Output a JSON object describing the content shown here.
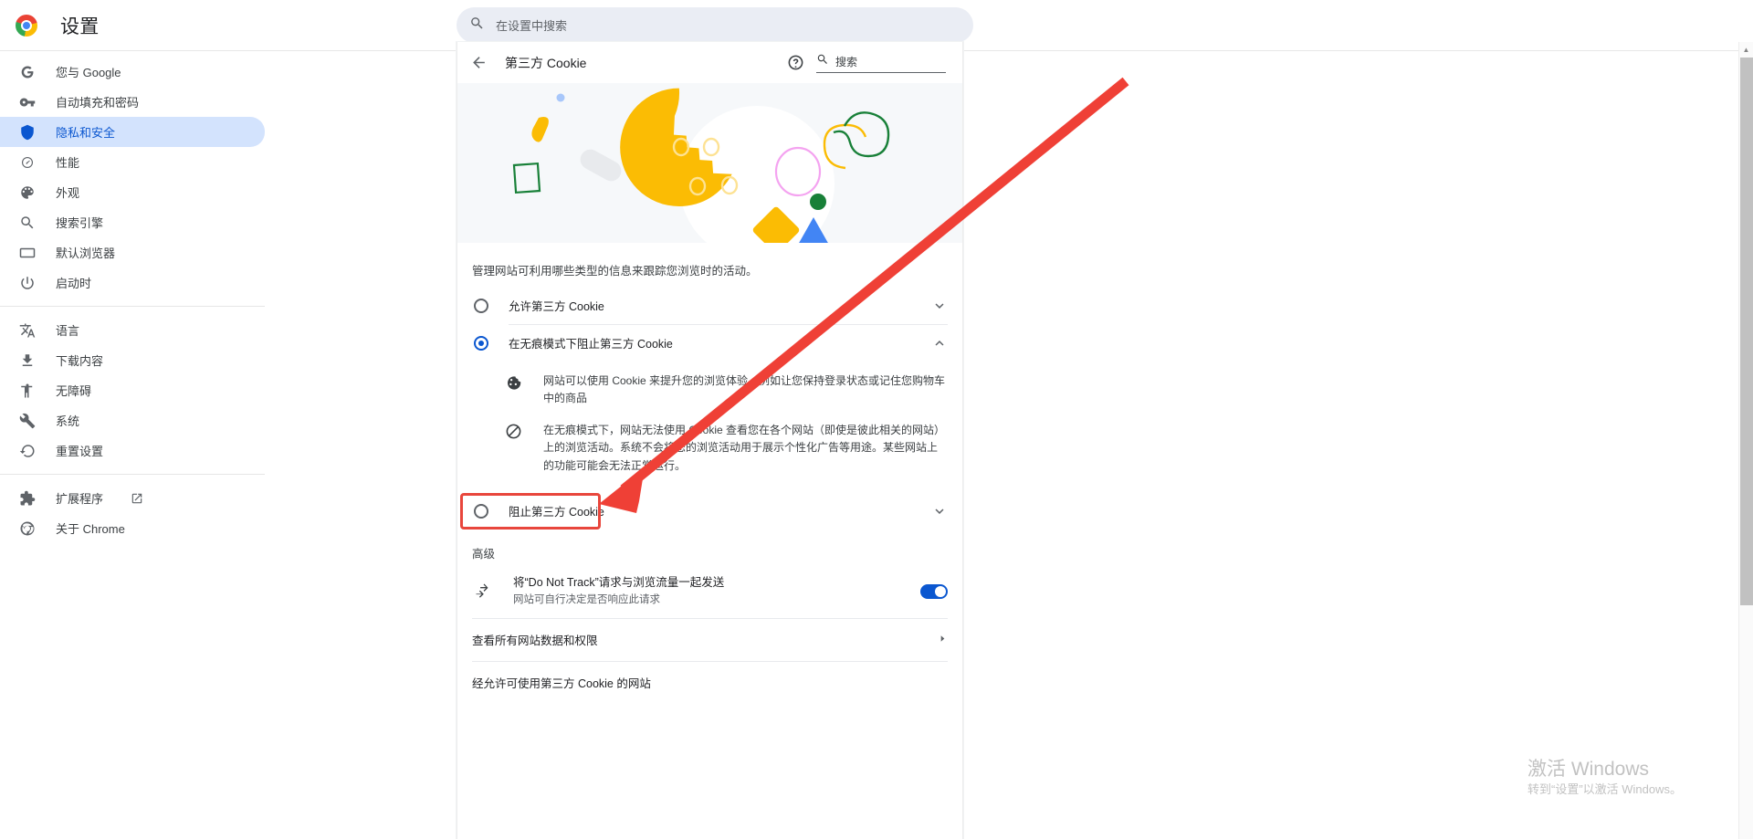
{
  "topbar": {
    "logo_icon": "chrome-logo",
    "title": "设置",
    "search_icon": "search-icon",
    "search_placeholder": "在设置中搜索"
  },
  "sidebar": {
    "items": [
      {
        "label": "您与 Google",
        "icon": "google-g-icon",
        "active": false
      },
      {
        "label": "自动填充和密码",
        "icon": "key-icon",
        "active": false
      },
      {
        "label": "隐私和安全",
        "icon": "shield-icon",
        "active": true
      },
      {
        "label": "性能",
        "icon": "speedometer-icon",
        "active": false
      },
      {
        "label": "外观",
        "icon": "palette-icon",
        "active": false
      },
      {
        "label": "搜索引擎",
        "icon": "search-icon",
        "active": false
      },
      {
        "label": "默认浏览器",
        "icon": "browser-window-icon",
        "active": false
      },
      {
        "label": "启动时",
        "icon": "power-icon",
        "active": false
      }
    ],
    "items2": [
      {
        "label": "语言",
        "icon": "translate-icon"
      },
      {
        "label": "下载内容",
        "icon": "download-icon"
      },
      {
        "label": "无障碍",
        "icon": "accessibility-icon"
      },
      {
        "label": "系统",
        "icon": "wrench-icon"
      },
      {
        "label": "重置设置",
        "icon": "restore-icon"
      }
    ],
    "items3": [
      {
        "label": "扩展程序",
        "icon": "extension-puzzle-icon",
        "external": true
      },
      {
        "label": "关于 Chrome",
        "icon": "chrome-outline-icon",
        "external": false
      }
    ]
  },
  "page": {
    "back_icon": "back-arrow-icon",
    "title": "第三方 Cookie",
    "help_icon": "help-circle-icon",
    "search_icon": "search-icon",
    "search_placeholder": "搜索",
    "banner_icon": "cookie-illustration",
    "description": "管理网站可利用哪些类型的信息来跟踪您浏览时的活动。",
    "options": [
      {
        "label": "允许第三方 Cookie",
        "selected": false,
        "expanded": false,
        "chevron_icon": "chevron-down-icon",
        "highlighted": false
      },
      {
        "label": "在无痕模式下阻止第三方 Cookie",
        "selected": true,
        "expanded": true,
        "chevron_icon": "chevron-up-icon",
        "highlighted": false,
        "details": [
          {
            "icon": "cookie-icon",
            "text": "网站可以使用 Cookie 来提升您的浏览体验，例如让您保持登录状态或记住您购物车中的商品"
          },
          {
            "icon": "block-icon",
            "text": "在无痕模式下，网站无法使用 Cookie 查看您在各个网站（即使是彼此相关的网站）上的浏览活动。系统不会将您的浏览活动用于展示个性化广告等用途。某些网站上的功能可能会无法正常运行。"
          }
        ]
      },
      {
        "label": "阻止第三方 Cookie",
        "selected": false,
        "expanded": false,
        "chevron_icon": "chevron-down-icon",
        "highlighted": true
      }
    ],
    "advanced_title": "高级",
    "do_not_track": {
      "icon": "redirect-arrow-icon",
      "title": "将“Do Not Track”请求与浏览流量一起发送",
      "subtitle": "网站可自行决定是否响应此请求",
      "toggle_on": true
    },
    "site_data_link": {
      "label": "查看所有网站数据和权限",
      "arrow_icon": "chevron-right-icon"
    },
    "allowed_sites_title": "经允许可使用第三方 Cookie 的网站"
  },
  "annotation": {
    "arrow_color": "#ef4036",
    "highlight_color": "#e8463c"
  },
  "watermark": {
    "line1": "激活 Windows",
    "line2": "转到“设置”以激活 Windows。"
  },
  "scrollbar": {
    "up_icon": "scroll-up-icon",
    "down_icon": "scroll-down-icon"
  }
}
